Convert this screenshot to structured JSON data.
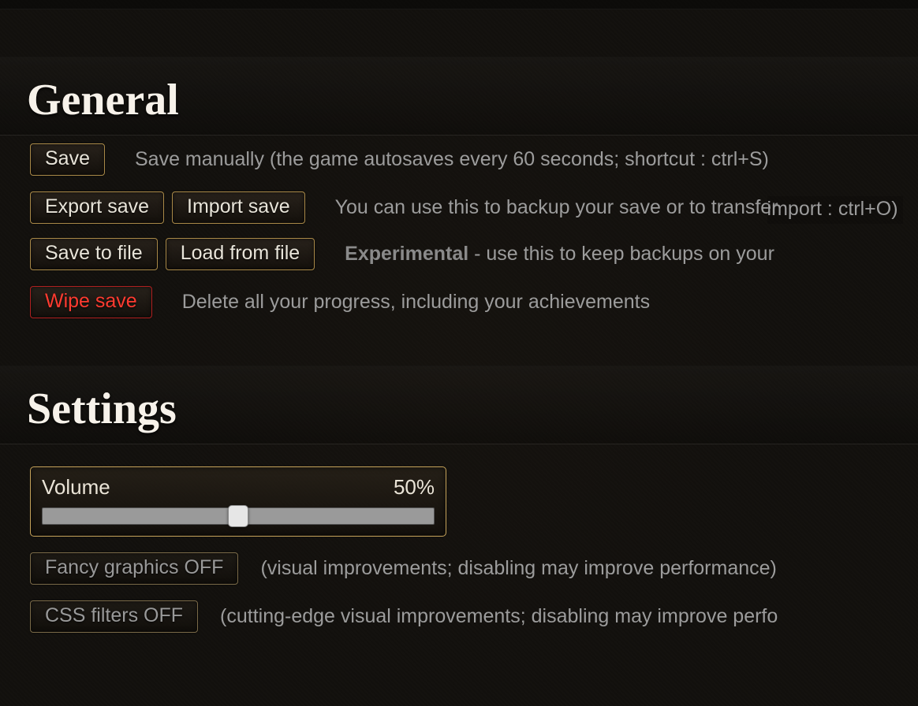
{
  "general": {
    "title": "General",
    "save": {
      "button": "Save",
      "desc": "Save manually (the game autosaves every 60 seconds; shortcut : ctrl+S)"
    },
    "export_import": {
      "export_button": "Export save",
      "import_button": "Import save",
      "desc_line1": "You can use this to backup your save or to transfer",
      "desc_line2": "import : ctrl+O)"
    },
    "file": {
      "save_button": "Save to file",
      "load_button": "Load from file",
      "desc_prefix_bold": "Experimental",
      "desc_rest": " - use this to keep backups on your"
    },
    "wipe": {
      "button": "Wipe save",
      "desc": "Delete all your progress, including your achievements"
    }
  },
  "settings": {
    "title": "Settings",
    "volume": {
      "label": "Volume",
      "value_text": "50%",
      "value_percent": 50
    },
    "fancy_graphics": {
      "button": "Fancy graphics OFF",
      "desc": "(visual improvements; disabling may improve performance)"
    },
    "css_filters": {
      "button": "CSS filters OFF",
      "desc": "(cutting-edge visual improvements; disabling may improve perfo"
    }
  }
}
